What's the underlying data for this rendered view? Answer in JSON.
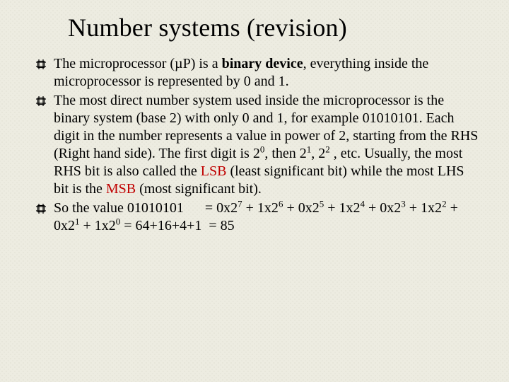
{
  "title": "Number systems (revision)",
  "bullet1": {
    "t1": "The microprocessor (µP) is a ",
    "t2": "binary device",
    "t3": ", everything inside the microprocessor is represented by 0 and 1."
  },
  "bullet2": {
    "t1": "The most direct number system used inside the microprocessor is the binary system (base 2) with only 0 and 1, for example 01010101. Each digit in the number represents a value in power of 2, starting from the RHS (Right hand side). The first digit is 2",
    "e1": "0",
    "t2": ", then 2",
    "e2": "1",
    "t3": ", 2",
    "e3": "2",
    "t4": " , etc. Usually, the most RHS bit is also called the ",
    "t5": "LSB",
    "t6": " (least significant bit) while the most LHS bit is the ",
    "t7": "MSB",
    "t8": " (most significant bit)."
  },
  "bullet3": {
    "t1": "So the value 01010101      = 0x2",
    "e1": "7",
    "t2": " + 1x2",
    "e2": "6",
    "t3": " + 0x2",
    "e3": "5",
    "t4": " + 1x2",
    "e4": "4",
    "t5": " + 0x2",
    "e5": "3",
    "t6": " + 1x2",
    "e6": "2",
    "t7": " + 0x2",
    "e7": "1",
    "t8": " + 1x2",
    "e8": "0",
    "t9": " = 64+16+4+1  = 85"
  }
}
